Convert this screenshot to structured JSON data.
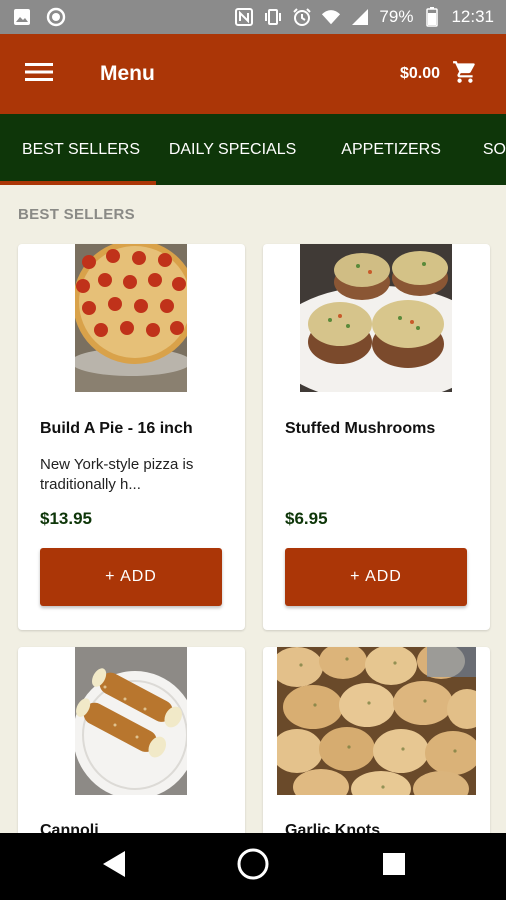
{
  "status_bar": {
    "battery_pct": "79%",
    "time": "12:31",
    "left_icons": [
      "image-icon",
      "circle-icon"
    ],
    "right_icons": [
      "nfc-icon",
      "vibrate-icon",
      "alarm-icon",
      "wifi-icon",
      "signal-icon",
      "battery-icon"
    ]
  },
  "app_bar": {
    "title": "Menu",
    "cart_total": "$0.00",
    "menu_icon": "hamburger-icon",
    "cart_icon": "shopping-cart-icon"
  },
  "tabs": [
    {
      "label": "BEST SELLERS",
      "active": true
    },
    {
      "label": "DAILY SPECIALS",
      "active": false
    },
    {
      "label": "APPETIZERS",
      "active": false
    },
    {
      "label": "SO",
      "active": false
    }
  ],
  "section_title": "BEST SELLERS",
  "items": [
    {
      "name": "Build A Pie - 16 inch",
      "description": "New York-style pizza is traditionally h...",
      "price": "$13.95",
      "add_label": "+ ADD",
      "image": "pizza"
    },
    {
      "name": "Stuffed Mushrooms",
      "description": "",
      "price": "$6.95",
      "add_label": "+ ADD",
      "image": "mushrooms"
    },
    {
      "name": "Cannoli",
      "image": "cannoli"
    },
    {
      "name": "Garlic Knots",
      "image": "garlic-knots"
    }
  ],
  "nav_bar": {
    "icons": [
      "back-icon",
      "home-icon",
      "recents-icon"
    ]
  },
  "colors": {
    "primary": "#ab3607",
    "tabs_bg": "#0e3609",
    "page_bg": "#f1efe3",
    "price": "#0e3609"
  }
}
